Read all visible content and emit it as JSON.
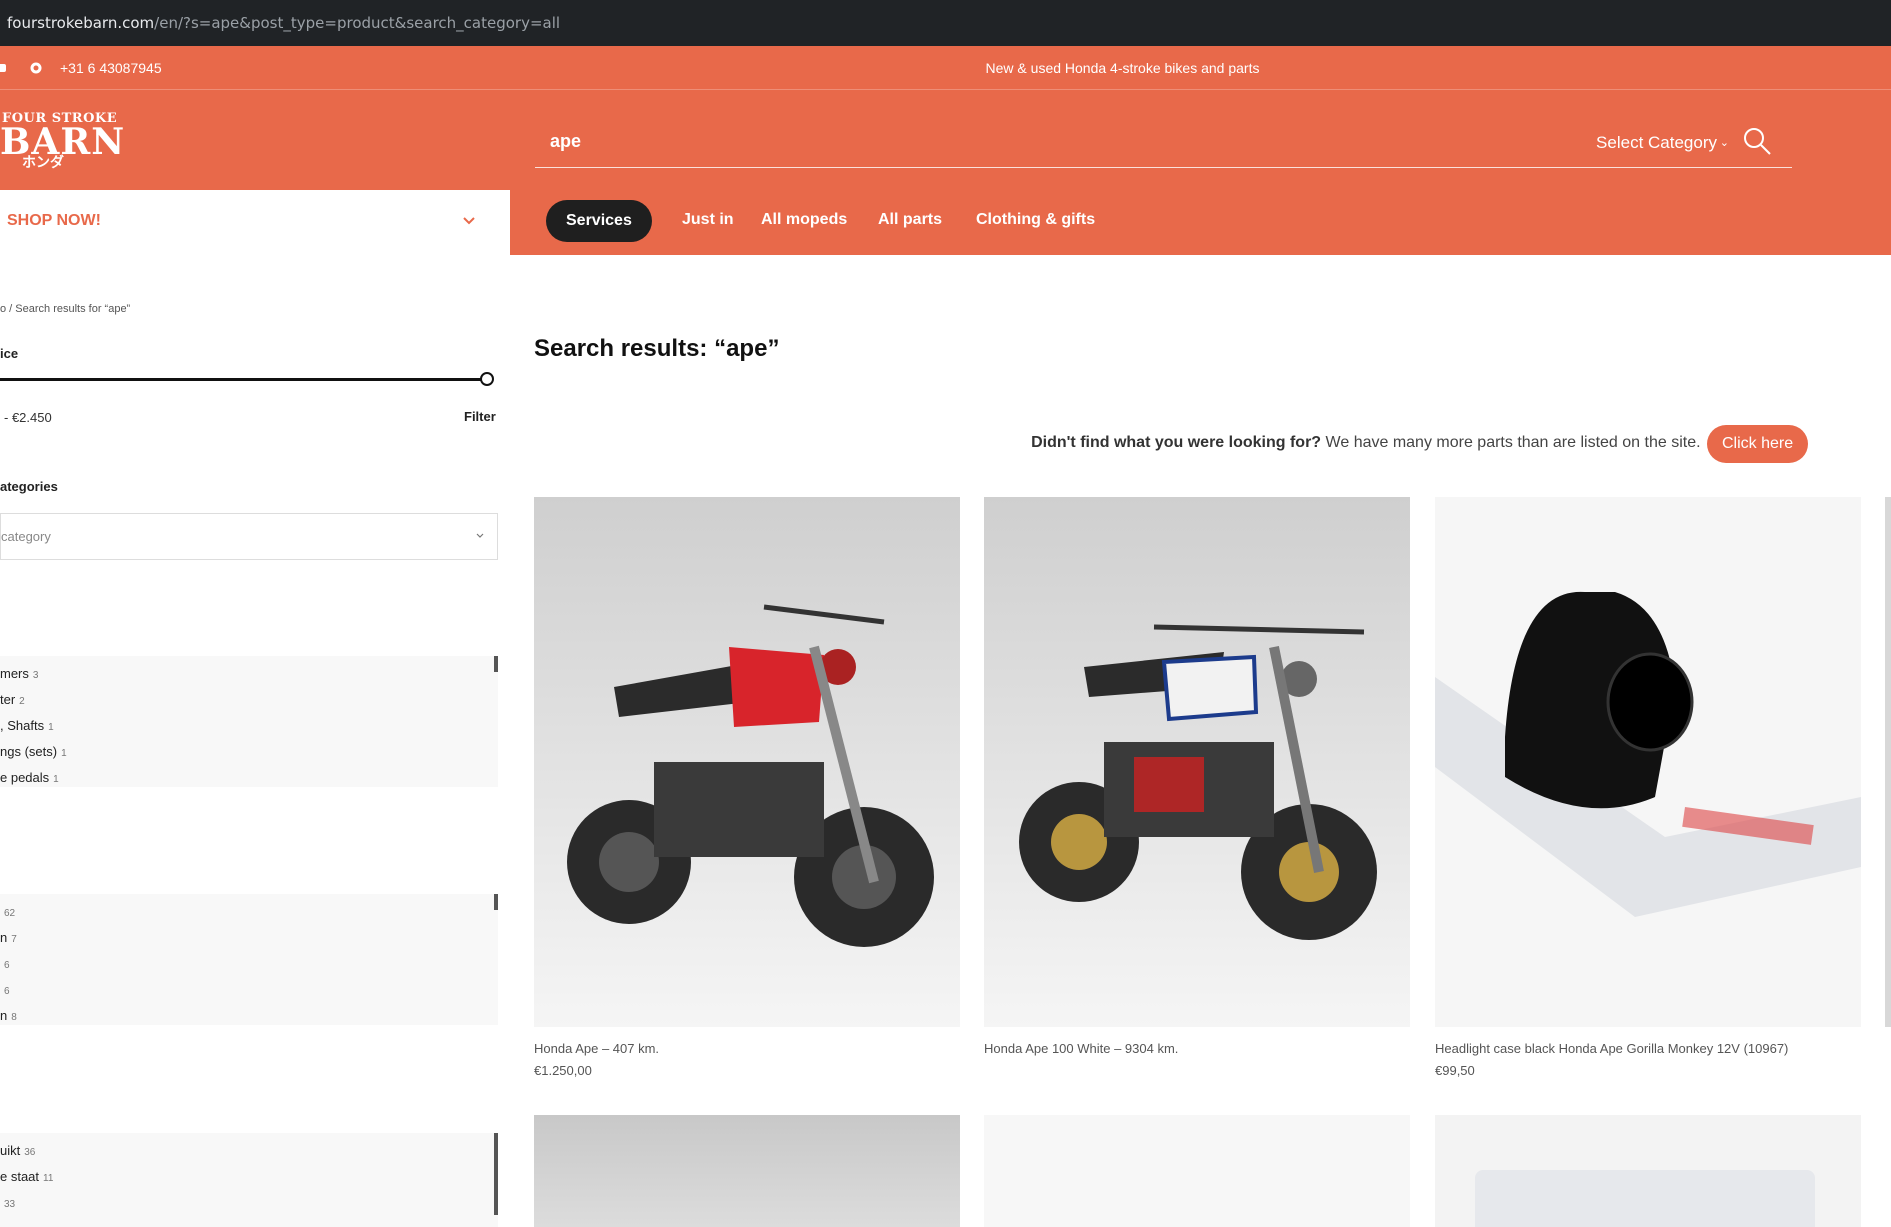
{
  "browser": {
    "url_domain": "fourstrokebarn.com",
    "url_path": "/en/?s=ape&post_type=product&search_category=all"
  },
  "topbar": {
    "phone": "+31 6 43087945",
    "tagline": "New & used Honda 4-stroke bikes and parts"
  },
  "logo": {
    "line1": "FOUR STROKE",
    "line2": "BARN",
    "line3": "ホンダ"
  },
  "search": {
    "query": "ape",
    "category_label": "Select Category"
  },
  "shop_now": "SHOP NOW!",
  "nav": {
    "active": "Services",
    "items": [
      "Just in",
      "All mopeds",
      "All parts",
      "Clothing & gifts"
    ]
  },
  "sidebar": {
    "breadcrumb": "o / Search results for “ape”",
    "price_heading": "ice",
    "price_range": "- €2.450",
    "filter_label": "Filter",
    "categories_heading": "ategories",
    "category_placeholder": "category",
    "list1": [
      {
        "label": "mers",
        "count": "3"
      },
      {
        "label": "ter",
        "count": "2"
      },
      {
        "label": ", Shafts",
        "count": "1"
      },
      {
        "label": "ngs (sets)",
        "count": "1"
      },
      {
        "label": "e pedals",
        "count": "1"
      }
    ],
    "list2": [
      {
        "label": "",
        "count": "62"
      },
      {
        "label": "n",
        "count": "7"
      },
      {
        "label": "",
        "count": "6"
      },
      {
        "label": "",
        "count": "6"
      },
      {
        "label": "n",
        "count": "8"
      }
    ],
    "list3": [
      {
        "label": "uikt",
        "count": "36"
      },
      {
        "label": "e staat",
        "count": "11"
      },
      {
        "label": "",
        "count": "33"
      }
    ]
  },
  "main": {
    "title": "Search results: “ape”",
    "notice_bold": "Didn't find what you were looking for?",
    "notice_text": "We have many more parts than are listed on the site.",
    "notice_button": "Click here",
    "products": [
      {
        "name": "Honda Ape – 407 km.",
        "price": "€1.250,00"
      },
      {
        "name": "Honda Ape 100 White – 9304 km.",
        "price": ""
      },
      {
        "name": "Headlight case black Honda Ape Gorilla Monkey 12V (10967)",
        "price": "€99,50"
      }
    ]
  },
  "colors": {
    "brand": "#e8694a",
    "dark": "#1f1f1f"
  }
}
